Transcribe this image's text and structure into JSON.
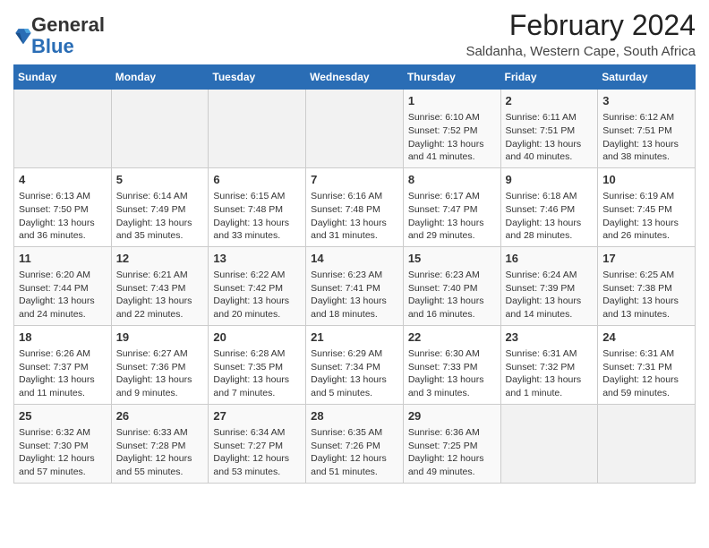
{
  "logo": {
    "general": "General",
    "blue": "Blue"
  },
  "title": "February 2024",
  "subtitle": "Saldanha, Western Cape, South Africa",
  "headers": [
    "Sunday",
    "Monday",
    "Tuesday",
    "Wednesday",
    "Thursday",
    "Friday",
    "Saturday"
  ],
  "rows": [
    [
      {
        "day": "",
        "info": ""
      },
      {
        "day": "",
        "info": ""
      },
      {
        "day": "",
        "info": ""
      },
      {
        "day": "",
        "info": ""
      },
      {
        "day": "1",
        "info": "Sunrise: 6:10 AM\nSunset: 7:52 PM\nDaylight: 13 hours and 41 minutes."
      },
      {
        "day": "2",
        "info": "Sunrise: 6:11 AM\nSunset: 7:51 PM\nDaylight: 13 hours and 40 minutes."
      },
      {
        "day": "3",
        "info": "Sunrise: 6:12 AM\nSunset: 7:51 PM\nDaylight: 13 hours and 38 minutes."
      }
    ],
    [
      {
        "day": "4",
        "info": "Sunrise: 6:13 AM\nSunset: 7:50 PM\nDaylight: 13 hours and 36 minutes."
      },
      {
        "day": "5",
        "info": "Sunrise: 6:14 AM\nSunset: 7:49 PM\nDaylight: 13 hours and 35 minutes."
      },
      {
        "day": "6",
        "info": "Sunrise: 6:15 AM\nSunset: 7:48 PM\nDaylight: 13 hours and 33 minutes."
      },
      {
        "day": "7",
        "info": "Sunrise: 6:16 AM\nSunset: 7:48 PM\nDaylight: 13 hours and 31 minutes."
      },
      {
        "day": "8",
        "info": "Sunrise: 6:17 AM\nSunset: 7:47 PM\nDaylight: 13 hours and 29 minutes."
      },
      {
        "day": "9",
        "info": "Sunrise: 6:18 AM\nSunset: 7:46 PM\nDaylight: 13 hours and 28 minutes."
      },
      {
        "day": "10",
        "info": "Sunrise: 6:19 AM\nSunset: 7:45 PM\nDaylight: 13 hours and 26 minutes."
      }
    ],
    [
      {
        "day": "11",
        "info": "Sunrise: 6:20 AM\nSunset: 7:44 PM\nDaylight: 13 hours and 24 minutes."
      },
      {
        "day": "12",
        "info": "Sunrise: 6:21 AM\nSunset: 7:43 PM\nDaylight: 13 hours and 22 minutes."
      },
      {
        "day": "13",
        "info": "Sunrise: 6:22 AM\nSunset: 7:42 PM\nDaylight: 13 hours and 20 minutes."
      },
      {
        "day": "14",
        "info": "Sunrise: 6:23 AM\nSunset: 7:41 PM\nDaylight: 13 hours and 18 minutes."
      },
      {
        "day": "15",
        "info": "Sunrise: 6:23 AM\nSunset: 7:40 PM\nDaylight: 13 hours and 16 minutes."
      },
      {
        "day": "16",
        "info": "Sunrise: 6:24 AM\nSunset: 7:39 PM\nDaylight: 13 hours and 14 minutes."
      },
      {
        "day": "17",
        "info": "Sunrise: 6:25 AM\nSunset: 7:38 PM\nDaylight: 13 hours and 13 minutes."
      }
    ],
    [
      {
        "day": "18",
        "info": "Sunrise: 6:26 AM\nSunset: 7:37 PM\nDaylight: 13 hours and 11 minutes."
      },
      {
        "day": "19",
        "info": "Sunrise: 6:27 AM\nSunset: 7:36 PM\nDaylight: 13 hours and 9 minutes."
      },
      {
        "day": "20",
        "info": "Sunrise: 6:28 AM\nSunset: 7:35 PM\nDaylight: 13 hours and 7 minutes."
      },
      {
        "day": "21",
        "info": "Sunrise: 6:29 AM\nSunset: 7:34 PM\nDaylight: 13 hours and 5 minutes."
      },
      {
        "day": "22",
        "info": "Sunrise: 6:30 AM\nSunset: 7:33 PM\nDaylight: 13 hours and 3 minutes."
      },
      {
        "day": "23",
        "info": "Sunrise: 6:31 AM\nSunset: 7:32 PM\nDaylight: 13 hours and 1 minute."
      },
      {
        "day": "24",
        "info": "Sunrise: 6:31 AM\nSunset: 7:31 PM\nDaylight: 12 hours and 59 minutes."
      }
    ],
    [
      {
        "day": "25",
        "info": "Sunrise: 6:32 AM\nSunset: 7:30 PM\nDaylight: 12 hours and 57 minutes."
      },
      {
        "day": "26",
        "info": "Sunrise: 6:33 AM\nSunset: 7:28 PM\nDaylight: 12 hours and 55 minutes."
      },
      {
        "day": "27",
        "info": "Sunrise: 6:34 AM\nSunset: 7:27 PM\nDaylight: 12 hours and 53 minutes."
      },
      {
        "day": "28",
        "info": "Sunrise: 6:35 AM\nSunset: 7:26 PM\nDaylight: 12 hours and 51 minutes."
      },
      {
        "day": "29",
        "info": "Sunrise: 6:36 AM\nSunset: 7:25 PM\nDaylight: 12 hours and 49 minutes."
      },
      {
        "day": "",
        "info": ""
      },
      {
        "day": "",
        "info": ""
      }
    ]
  ]
}
